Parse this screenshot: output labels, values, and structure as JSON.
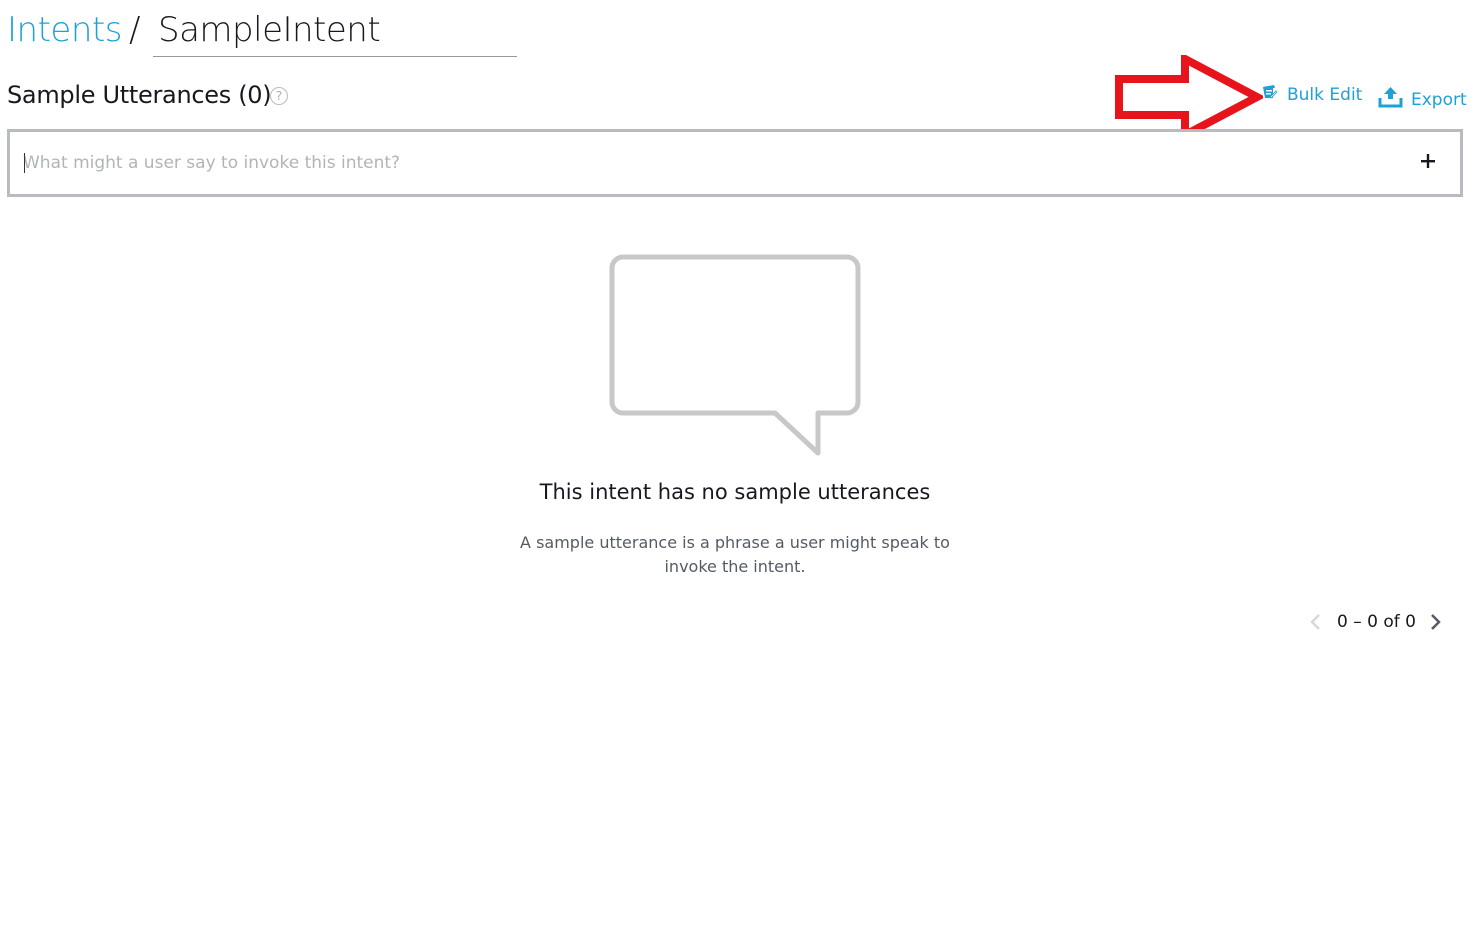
{
  "breadcrumb": {
    "parent": "Intents",
    "separator": "/",
    "current": "SampleIntent"
  },
  "section": {
    "title": "Sample Utterances (0)",
    "help_icon": "question-circle-icon"
  },
  "actions": {
    "bulk_edit_label": "Bulk Edit",
    "bulk_edit_icon": "bulk-edit-icon",
    "export_label": "Export",
    "export_icon": "upload-icon"
  },
  "utterance_input": {
    "placeholder": "What might a user say to invoke this intent?",
    "value": "",
    "add_icon": "plus-icon"
  },
  "empty_state": {
    "icon": "speech-bubble-icon",
    "title": "This intent has no sample utterances",
    "description": "A sample utterance is a phrase a user might speak to invoke the intent."
  },
  "pagination": {
    "range_text": "0 – 0 of 0"
  },
  "colors": {
    "link": "#1fa1d6",
    "text": "#16191f",
    "muted": "#545b64",
    "border": "#b8bcc0",
    "annotation": "#e8141c"
  }
}
